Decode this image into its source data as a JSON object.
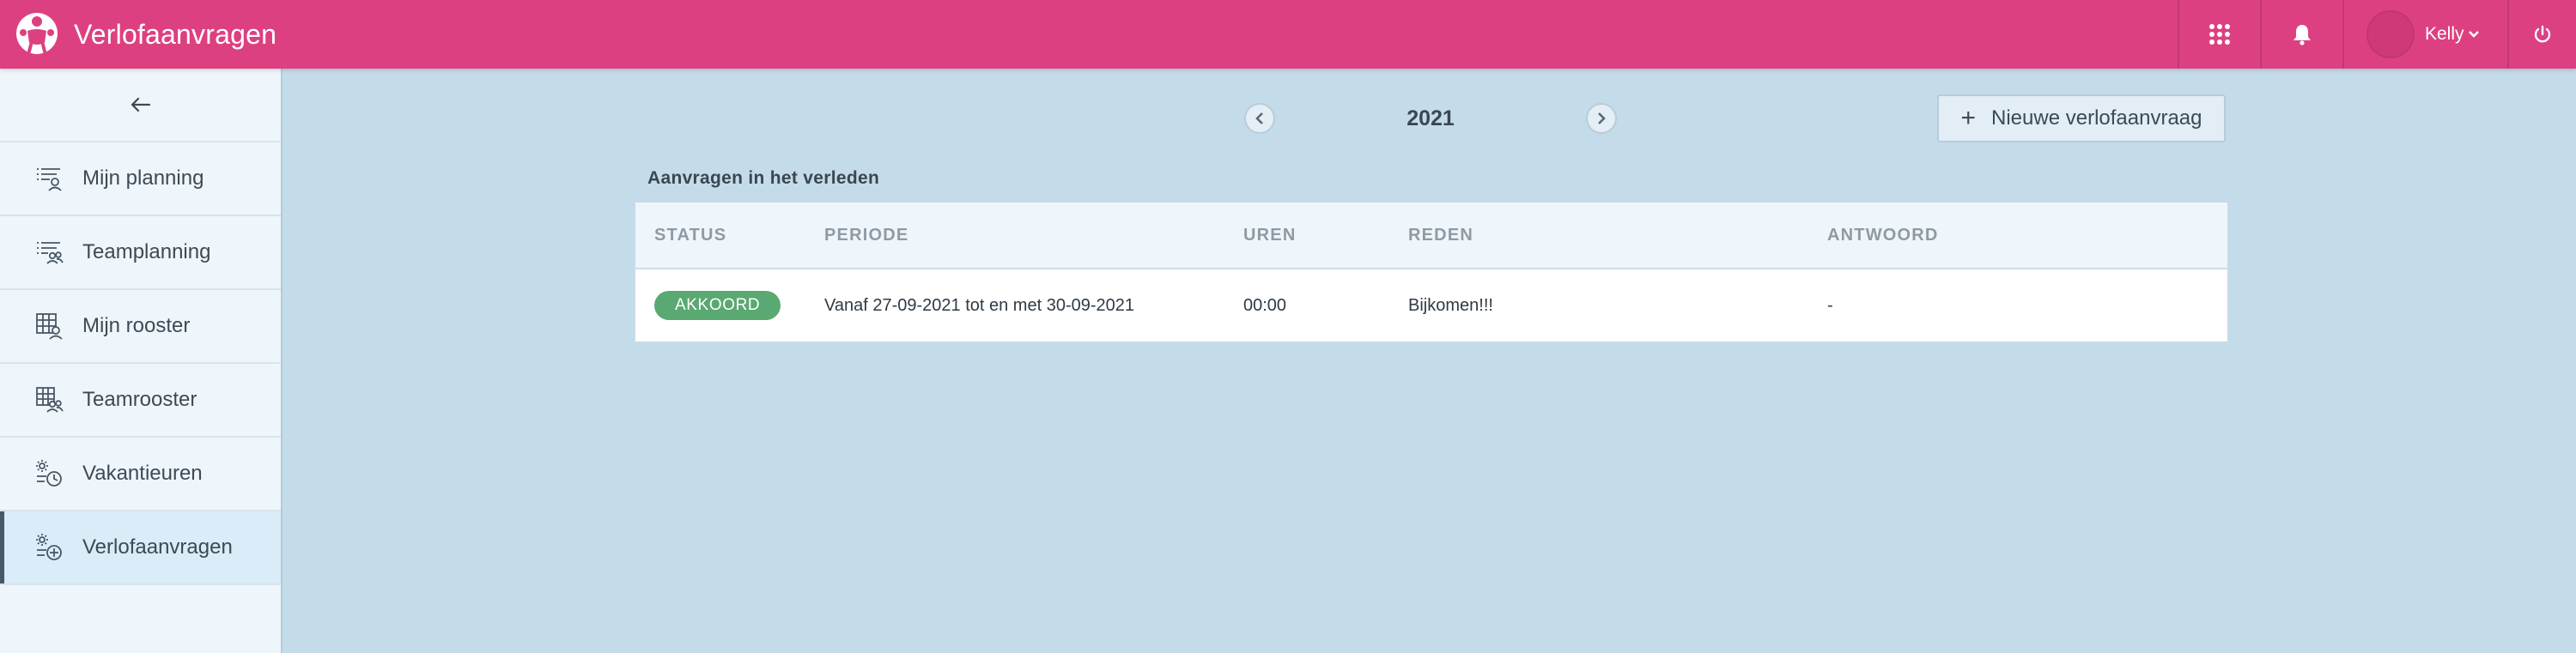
{
  "app": {
    "title": "Verlofaanvragen",
    "brand_color": "#dd4080"
  },
  "topbar": {
    "user_name": "Kelly",
    "icons": [
      "apps-grid-icon",
      "bell-icon",
      "chevron-down-icon",
      "power-icon"
    ]
  },
  "sidebar": {
    "back_icon": "arrow-left-icon",
    "items": [
      {
        "label": "Mijn planning",
        "icon": "list-user-icon",
        "active": false
      },
      {
        "label": "Teamplanning",
        "icon": "list-team-icon",
        "active": false
      },
      {
        "label": "Mijn rooster",
        "icon": "grid-user-icon",
        "active": false
      },
      {
        "label": "Teamrooster",
        "icon": "grid-team-icon",
        "active": false
      },
      {
        "label": "Vakantieuren",
        "icon": "sun-clock-icon",
        "active": false
      },
      {
        "label": "Verlofaanvragen",
        "icon": "sun-plus-icon",
        "active": true
      }
    ]
  },
  "year_nav": {
    "year": "2021"
  },
  "actions": {
    "new_request_label": "Nieuwe verlofaanvraag"
  },
  "past_requests": {
    "section_title": "Aanvragen in het verleden",
    "columns": [
      "STATUS",
      "PERIODE",
      "UREN",
      "REDEN",
      "ANTWOORD"
    ],
    "rows": [
      {
        "status": "AKKOORD",
        "status_color": "#5aa872",
        "period": "Vanaf 27-09-2021 tot en met 30-09-2021",
        "hours": "00:00",
        "reason": "Bijkomen!!!",
        "answer": "-"
      }
    ]
  }
}
